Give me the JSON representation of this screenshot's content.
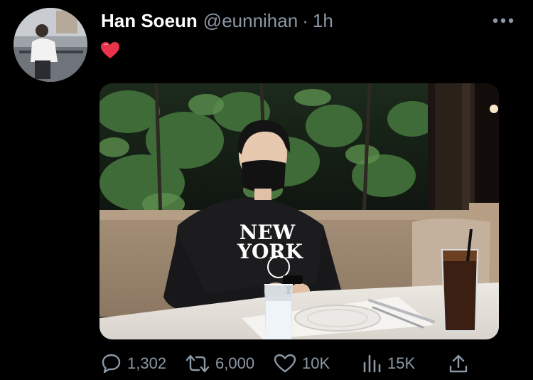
{
  "tweet": {
    "display_name": "Han Soeun",
    "handle": "@eunnihan",
    "separator": "·",
    "time": "1h",
    "text": "❤️",
    "media_text": [
      "NEW",
      "YORK"
    ]
  },
  "actions": {
    "reply_count": "1,302",
    "retweet_count": "6,000",
    "like_count": "10K",
    "views_count": "15K"
  },
  "icons": {
    "reply": "speech-bubble-icon",
    "retweet": "retweet-icon",
    "like": "heart-icon",
    "views": "bar-chart-icon",
    "share": "share-icon",
    "more": "more-dots-icon"
  },
  "colors": {
    "background": "#000000",
    "text_primary": "#ffffff",
    "text_secondary": "#8b98a5",
    "heart": "#e0245e"
  }
}
